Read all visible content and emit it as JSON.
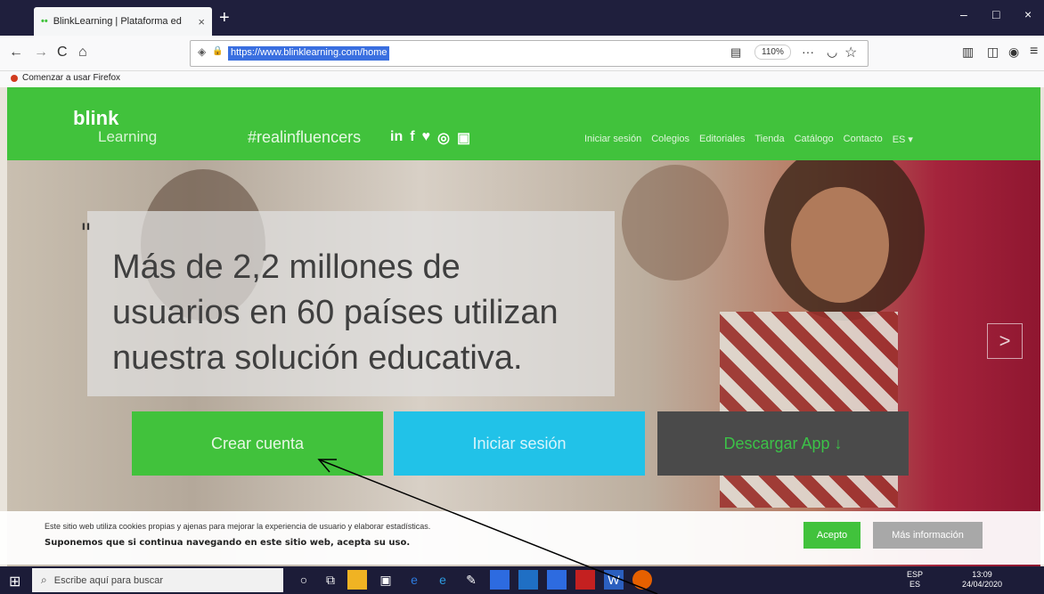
{
  "browser": {
    "tab_title": "BlinkLearning | Plataforma ed",
    "tab_favicon": "••",
    "tab_close": "×",
    "new_tab": "+",
    "url": "https://www.blinklearning.com/home",
    "zoom": "110%",
    "bookmark": "Comenzar a usar Firefox",
    "icons": {
      "back": "←",
      "forward": "→",
      "reload": "C",
      "home": "⌂",
      "shield": "◈",
      "lock": "🔒",
      "reader": "▤",
      "more": "···",
      "pocket": "◡",
      "star": "☆",
      "library": "▥",
      "sidebar": "◫",
      "account": "◉",
      "menu": "≡",
      "minimize": "–",
      "maximize": "□",
      "close": "×"
    }
  },
  "site": {
    "logo_main": "blink",
    "logo_sub": "Learning",
    "hashtag": "#realinfluencers",
    "social": [
      "in",
      "f",
      "♥",
      "◎",
      "▣"
    ],
    "menu": [
      "Iniciar sesión",
      "Colegios",
      "Editoriales",
      "Tienda",
      "Catálogo",
      "Contacto",
      "ES ▾"
    ]
  },
  "hero": {
    "quote": "\"",
    "headline": "Más de 2,2 millones de usuarios en 60 países utilizan nuestra solución educativa.",
    "next_arrow": ">"
  },
  "buttons": {
    "create": "Crear cuenta",
    "login": "Iniciar sesión",
    "app": "Descargar App ↓"
  },
  "cookie": {
    "line1": "Este sitio web utiliza cookies propias y ajenas para mejorar la experiencia de usuario y elaborar estadísticas.",
    "line2": "Suponemos que si continua navegando en este sitio web, acepta su uso.",
    "accept": "Acepto",
    "more": "Más información"
  },
  "taskbar": {
    "start": "⊞",
    "search_icon": "⌕",
    "search_placeholder": "Escribe aquí para buscar",
    "tray_lang": "ESP",
    "tray_region": "ES",
    "tray_time": "13:09",
    "tray_date": "24/04/2020"
  },
  "colors": {
    "brand_green": "#41c23c",
    "cyan": "#21c2e8",
    "dark": "#4a4a4a"
  }
}
